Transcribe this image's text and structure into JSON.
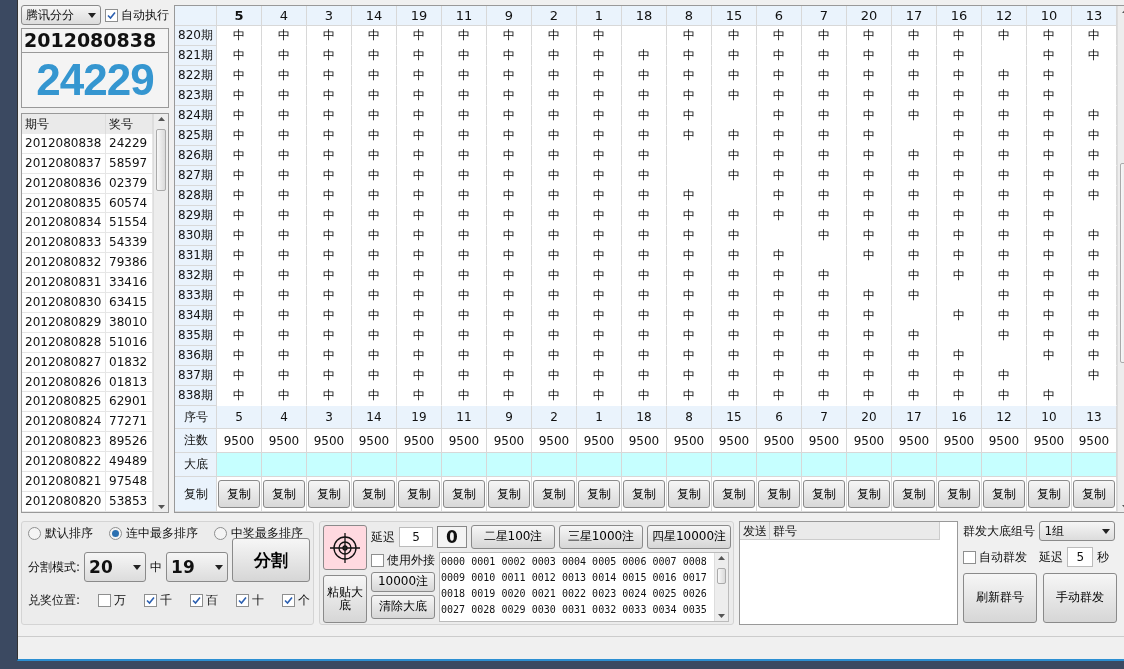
{
  "source_select": {
    "value": "腾讯分分"
  },
  "auto_run": {
    "label": "自动执行",
    "checked": true
  },
  "current": {
    "issue": "2012080838",
    "number": "24229"
  },
  "history": {
    "columns": [
      "期号",
      "奖号"
    ],
    "rows": [
      [
        "2012080838",
        "24229"
      ],
      [
        "2012080837",
        "58597"
      ],
      [
        "2012080836",
        "02379"
      ],
      [
        "2012080835",
        "60574"
      ],
      [
        "2012080834",
        "51554"
      ],
      [
        "2012080833",
        "54339"
      ],
      [
        "2012080832",
        "79386"
      ],
      [
        "2012080831",
        "33416"
      ],
      [
        "2012080830",
        "63415"
      ],
      [
        "2012080829",
        "38010"
      ],
      [
        "2012080828",
        "51016"
      ],
      [
        "2012080827",
        "01832"
      ],
      [
        "2012080826",
        "01813"
      ],
      [
        "2012080825",
        "62901"
      ],
      [
        "2012080824",
        "77271"
      ],
      [
        "2012080823",
        "89526"
      ],
      [
        "2012080822",
        "49489"
      ],
      [
        "2012080821",
        "97548"
      ],
      [
        "2012080820",
        "53853"
      ]
    ]
  },
  "grid": {
    "columns": [
      "5",
      "4",
      "3",
      "14",
      "19",
      "11",
      "9",
      "2",
      "1",
      "18",
      "8",
      "15",
      "6",
      "7",
      "20",
      "17",
      "16",
      "12",
      "10",
      "13"
    ],
    "rows": [
      {
        "label": "820期",
        "cells": [
          "中",
          "中",
          "中",
          "中",
          "中",
          "中",
          "中",
          "中",
          "中",
          null,
          "中",
          "中",
          "中",
          "中",
          "中",
          "中",
          "中",
          "中",
          "中",
          "中"
        ]
      },
      {
        "label": "821期",
        "cells": [
          "中",
          "中",
          "中",
          "中",
          "中",
          "中",
          "中",
          "中",
          "中",
          "中",
          "中",
          "中",
          "中",
          "中",
          "中",
          "中",
          "中",
          null,
          "中",
          "中"
        ]
      },
      {
        "label": "822期",
        "cells": [
          "中",
          "中",
          "中",
          "中",
          "中",
          "中",
          "中",
          "中",
          "中",
          "中",
          "中",
          "中",
          "中",
          "中",
          "中",
          "中",
          "中",
          "中",
          "中",
          null
        ]
      },
      {
        "label": "823期",
        "cells": [
          "中",
          "中",
          "中",
          "中",
          "中",
          "中",
          "中",
          "中",
          "中",
          "中",
          "中",
          "中",
          "中",
          "中",
          "中",
          "中",
          "中",
          "中",
          "中",
          null
        ]
      },
      {
        "label": "824期",
        "cells": [
          "中",
          "中",
          "中",
          "中",
          "中",
          "中",
          "中",
          "中",
          "中",
          "中",
          "中",
          null,
          "中",
          "中",
          "中",
          "中",
          "中",
          "中",
          "中",
          "中"
        ]
      },
      {
        "label": "825期",
        "cells": [
          "中",
          "中",
          "中",
          "中",
          "中",
          "中",
          "中",
          "中",
          "中",
          "中",
          "中",
          "中",
          "中",
          "中",
          "中",
          null,
          "中",
          "中",
          "中",
          "中"
        ]
      },
      {
        "label": "826期",
        "cells": [
          "中",
          "中",
          "中",
          "中",
          "中",
          "中",
          "中",
          "中",
          "中",
          "中",
          null,
          "中",
          "中",
          "中",
          "中",
          "中",
          "中",
          "中",
          "中",
          "中"
        ]
      },
      {
        "label": "827期",
        "cells": [
          "中",
          "中",
          "中",
          "中",
          "中",
          "中",
          "中",
          "中",
          "中",
          "中",
          null,
          "中",
          "中",
          "中",
          "中",
          "中",
          "中",
          "中",
          "中",
          "中"
        ]
      },
      {
        "label": "828期",
        "cells": [
          "中",
          "中",
          "中",
          "中",
          "中",
          "中",
          "中",
          "中",
          "中",
          "中",
          "中",
          null,
          "中",
          "中",
          "中",
          "中",
          "中",
          "中",
          "中",
          "中"
        ]
      },
      {
        "label": "829期",
        "cells": [
          "中",
          "中",
          "中",
          "中",
          "中",
          "中",
          "中",
          "中",
          "中",
          "中",
          "中",
          "中",
          "中",
          "中",
          "中",
          "中",
          "中",
          "中",
          "中",
          null
        ]
      },
      {
        "label": "830期",
        "cells": [
          "中",
          "中",
          "中",
          "中",
          "中",
          "中",
          "中",
          "中",
          "中",
          "中",
          "中",
          "中",
          null,
          "中",
          "中",
          "中",
          "中",
          "中",
          "中",
          "中"
        ]
      },
      {
        "label": "831期",
        "cells": [
          "中",
          "中",
          "中",
          "中",
          "中",
          "中",
          "中",
          "中",
          "中",
          "中",
          "中",
          "中",
          "中",
          null,
          "中",
          "中",
          "中",
          "中",
          "中",
          "中"
        ]
      },
      {
        "label": "832期",
        "cells": [
          "中",
          "中",
          "中",
          "中",
          "中",
          "中",
          "中",
          "中",
          "中",
          "中",
          "中",
          "中",
          "中",
          "中",
          null,
          "中",
          "中",
          "中",
          "中",
          "中"
        ]
      },
      {
        "label": "833期",
        "cells": [
          "中",
          "中",
          "中",
          "中",
          "中",
          "中",
          "中",
          "中",
          "中",
          "中",
          "中",
          "中",
          "中",
          "中",
          "中",
          "中",
          null,
          "中",
          "中",
          "中"
        ]
      },
      {
        "label": "834期",
        "cells": [
          "中",
          "中",
          "中",
          "中",
          "中",
          "中",
          "中",
          "中",
          "中",
          "中",
          "中",
          "中",
          "中",
          "中",
          "中",
          null,
          "中",
          "中",
          "中",
          "中"
        ]
      },
      {
        "label": "835期",
        "cells": [
          "中",
          "中",
          "中",
          "中",
          "中",
          "中",
          "中",
          "中",
          "中",
          "中",
          "中",
          "中",
          "中",
          "中",
          "中",
          "中",
          null,
          "中",
          "中",
          "中"
        ]
      },
      {
        "label": "836期",
        "cells": [
          "中",
          "中",
          "中",
          "中",
          "中",
          "中",
          "中",
          "中",
          "中",
          "中",
          "中",
          "中",
          "中",
          "中",
          "中",
          "中",
          "中",
          null,
          "中",
          "中"
        ]
      },
      {
        "label": "837期",
        "cells": [
          "中",
          "中",
          "中",
          "中",
          "中",
          "中",
          "中",
          "中",
          "中",
          "中",
          "中",
          "中",
          "中",
          "中",
          "中",
          "中",
          "中",
          "中",
          null,
          "中"
        ]
      },
      {
        "label": "838期",
        "cells": [
          "中",
          "中",
          "中",
          "中",
          "中",
          "中",
          "中",
          "中",
          "中",
          "中",
          "中",
          "中",
          "中",
          "中",
          "中",
          "中",
          "中",
          "中",
          "中",
          null
        ]
      }
    ],
    "seq_label": "序号",
    "seq": [
      "5",
      "4",
      "3",
      "14",
      "19",
      "11",
      "9",
      "2",
      "1",
      "18",
      "8",
      "15",
      "6",
      "7",
      "20",
      "17",
      "16",
      "12",
      "10",
      "13"
    ],
    "count_label": "注数",
    "counts": [
      "9500",
      "9500",
      "9500",
      "9500",
      "9500",
      "9500",
      "9500",
      "9500",
      "9500",
      "9500",
      "9500",
      "9500",
      "9500",
      "9500",
      "9500",
      "9500",
      "9500",
      "9500",
      "9500",
      "9500"
    ],
    "base_label": "大底",
    "copy_label": "复制",
    "copy_buttons": [
      "复制",
      "复制",
      "复制",
      "复制",
      "复制",
      "复制",
      "复制",
      "复制",
      "复制",
      "复制",
      "复制",
      "复制",
      "复制",
      "复制",
      "复制",
      "复制",
      "复制",
      "复制",
      "复制",
      "复制"
    ]
  },
  "sort_options": [
    {
      "label": "默认排序",
      "selected": false
    },
    {
      "label": "连中最多排序",
      "selected": true
    },
    {
      "label": "中奖最多排序",
      "selected": false
    }
  ],
  "split": {
    "label": "分割模式:",
    "from": "20",
    "mid": "中",
    "to": "19",
    "button": "分割"
  },
  "prize_positions": {
    "label": "兑奖位置:",
    "options": [
      {
        "label": "万",
        "checked": false
      },
      {
        "label": "千",
        "checked": true
      },
      {
        "label": "百",
        "checked": true
      },
      {
        "label": "十",
        "checked": true
      },
      {
        "label": "个",
        "checked": true
      }
    ]
  },
  "tools": {
    "paste_button": "粘贴大底",
    "delay_label": "延迟",
    "delay": "5",
    "counter": "0",
    "star_buttons": [
      "二星100注",
      "三星1000注",
      "四星10000注"
    ],
    "use_external": {
      "label": "使用外接",
      "checked": false
    },
    "count_button": "10000注",
    "clear_button": "清除大底",
    "numbers": [
      "0000",
      "0001",
      "0002",
      "0003",
      "0004",
      "0005",
      "0006",
      "0007",
      "0008",
      "0009",
      "0010",
      "0011",
      "0012",
      "0013",
      "0014",
      "0015",
      "0016",
      "0017",
      "0018",
      "0019",
      "0020",
      "0021",
      "0022",
      "0023",
      "0024",
      "0025",
      "0026",
      "0027",
      "0028",
      "0029",
      "0030",
      "0031",
      "0032",
      "0033",
      "0034",
      "0035"
    ]
  },
  "send_list": {
    "columns": [
      "发送",
      "群号"
    ]
  },
  "group_send": {
    "label": "群发大底组号",
    "select": "1组",
    "auto_send": {
      "label": "自动群发",
      "checked": false
    },
    "delay_label": "延迟",
    "delay": "5",
    "unit": "秒",
    "buttons": [
      "刷新群号",
      "手动群发"
    ]
  }
}
